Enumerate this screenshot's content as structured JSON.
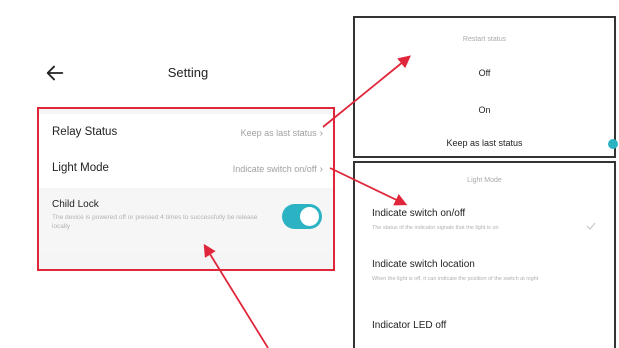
{
  "header": {
    "title": "Setting",
    "back_icon": "arrow-left-icon"
  },
  "settings": {
    "relay_status": {
      "label": "Relay Status",
      "value": "Keep as last status"
    },
    "light_mode": {
      "label": "Light Mode",
      "value": "Indicate switch on/off"
    },
    "child_lock": {
      "label": "Child Lock",
      "description": "The device is powered off or pressed 4 times to successfully be release locally",
      "enabled": true
    },
    "chevron": "›"
  },
  "restart_status": {
    "title": "Restart status",
    "options": [
      "Off",
      "On",
      "Keep as last status"
    ],
    "selected_index": 2
  },
  "light_mode_panel": {
    "title": "Light Mode",
    "options": [
      {
        "name": "Indicate switch on/off",
        "desc": "The status of the indicator signals that the light is on"
      },
      {
        "name": "Indicate switch location",
        "desc": "When the light is off, it can indicate the position of the switch at night"
      },
      {
        "name": "Indicator LED off",
        "desc": ""
      }
    ],
    "selected_index": 0
  },
  "colors": {
    "accent": "#2bb3c4",
    "highlight_box": "#e0263a",
    "arrow": "#e0263a"
  }
}
